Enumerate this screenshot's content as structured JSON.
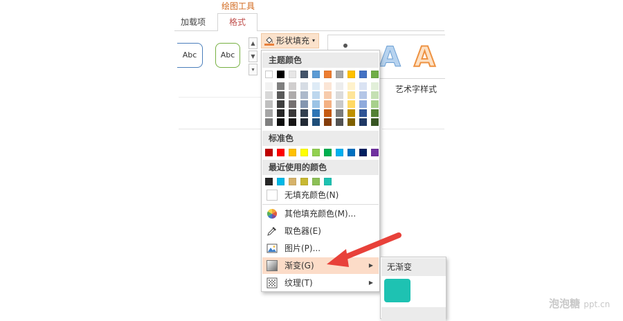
{
  "ribbon": {
    "tool_group_label": "绘图工具",
    "tabs": [
      {
        "label": "加载项",
        "active": false
      },
      {
        "label": "格式",
        "active": true
      }
    ],
    "shape_styles": [
      {
        "label": "Abc",
        "outline_color": "#4a7ebb"
      },
      {
        "label": "Abc",
        "outline_color": "#76b041"
      }
    ],
    "shape_fill_button": {
      "label": "形状填充",
      "icon": "paint-bucket-icon",
      "caret": "▾"
    },
    "wordart": {
      "section_label": "艺术字样式",
      "sample_letter": "A",
      "colors": [
        "#6b9fd3",
        "#ee9242"
      ]
    }
  },
  "fill_menu": {
    "theme_colors_header": "主题颜色",
    "theme_colors_top": [
      "#ffffff",
      "#000000",
      "#e7e6e6",
      "#44546a",
      "#5b9bd5",
      "#ed7d31",
      "#a5a5a5",
      "#ffc000",
      "#4472c4",
      "#70ad47"
    ],
    "theme_color_shades": [
      [
        "#f2f2f2",
        "#7f7f7f",
        "#d0cece",
        "#d6dce4",
        "#deebf6",
        "#fbe5d5",
        "#ededed",
        "#fff2cc",
        "#dae3f3",
        "#e2efd9"
      ],
      [
        "#d8d8d8",
        "#595959",
        "#aeabab",
        "#adb9ca",
        "#bdd7ee",
        "#f7cbac",
        "#dbdbdb",
        "#fee599",
        "#b4c6e7",
        "#c5e0b3"
      ],
      [
        "#bfbfbf",
        "#3f3f3f",
        "#757070",
        "#8496b0",
        "#9cc3e5",
        "#f4b183",
        "#c9c9c9",
        "#ffd965",
        "#8faadc",
        "#a8d08d"
      ],
      [
        "#a5a5a5",
        "#262626",
        "#3a3838",
        "#323f4f",
        "#2e75b5",
        "#c55a11",
        "#7b7b7b",
        "#bf9000",
        "#2f5496",
        "#538135"
      ],
      [
        "#7f7f7f",
        "#0c0c0c",
        "#171616",
        "#222a35",
        "#1e4e79",
        "#833c0b",
        "#525252",
        "#7f6000",
        "#1f3864",
        "#375623"
      ]
    ],
    "standard_colors_header": "标准色",
    "standard_colors": [
      "#c00000",
      "#ff0000",
      "#ffc000",
      "#ffff00",
      "#92d050",
      "#00b050",
      "#00b0f0",
      "#0070c0",
      "#002060",
      "#7030a0"
    ],
    "recent_colors_header": "最近使用的颜色",
    "recent_colors": [
      "#262626",
      "#00b8e6",
      "#d6b26a",
      "#c8b832",
      "#8cbf56",
      "#1ec2b2"
    ],
    "items": [
      {
        "label": "无填充颜色(N)",
        "icon": "no-fill-icon",
        "has_submenu": false
      },
      {
        "label": "其他填充颜色(M)...",
        "icon": "color-wheel-icon",
        "has_submenu": false
      },
      {
        "label": "取色器(E)",
        "icon": "eyedropper-icon",
        "has_submenu": false
      },
      {
        "label": "图片(P)...",
        "icon": "picture-icon",
        "has_submenu": false
      },
      {
        "label": "渐变(G)",
        "icon": "gradient-icon",
        "has_submenu": true,
        "highlighted": true
      },
      {
        "label": "纹理(T)",
        "icon": "texture-icon",
        "has_submenu": true
      }
    ]
  },
  "gradient_submenu": {
    "header": "无渐变",
    "swatch_color": "#1ec2b2"
  },
  "watermark": {
    "brand": "泡泡糖",
    "domain": "ppt.cn"
  },
  "annotation": {
    "arrow_color": "#e8413a"
  }
}
